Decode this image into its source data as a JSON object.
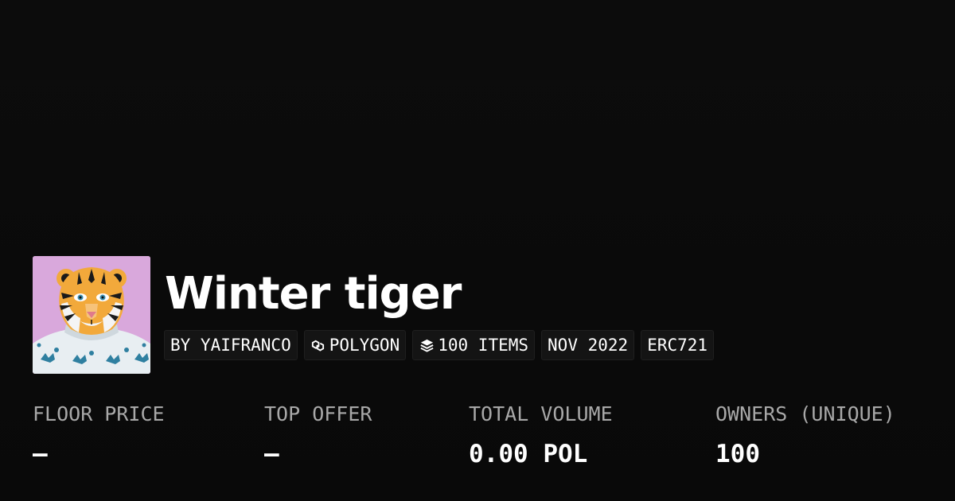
{
  "collection": {
    "title": "Winter tiger",
    "avatar_icon": "tiger-avatar-icon"
  },
  "badges": {
    "creator": "BY YAIFRANCO",
    "chain": "POLYGON",
    "chain_icon": "polygon-icon",
    "items": "100 ITEMS",
    "items_icon": "layers-icon",
    "date": "NOV 2022",
    "standard": "ERC721"
  },
  "stats": {
    "floor_price_label": "FLOOR PRICE",
    "floor_price_value": "–",
    "top_offer_label": "TOP OFFER",
    "top_offer_value": "–",
    "total_volume_label": "TOTAL VOLUME",
    "total_volume_value": "0.00 POL",
    "owners_label": "OWNERS (UNIQUE)",
    "owners_value": "100"
  },
  "colors": {
    "background": "#0a0a0a",
    "avatar_background": "#d9a8dc",
    "badge_background": "#141414",
    "label_gray": "#a8a8a8"
  }
}
